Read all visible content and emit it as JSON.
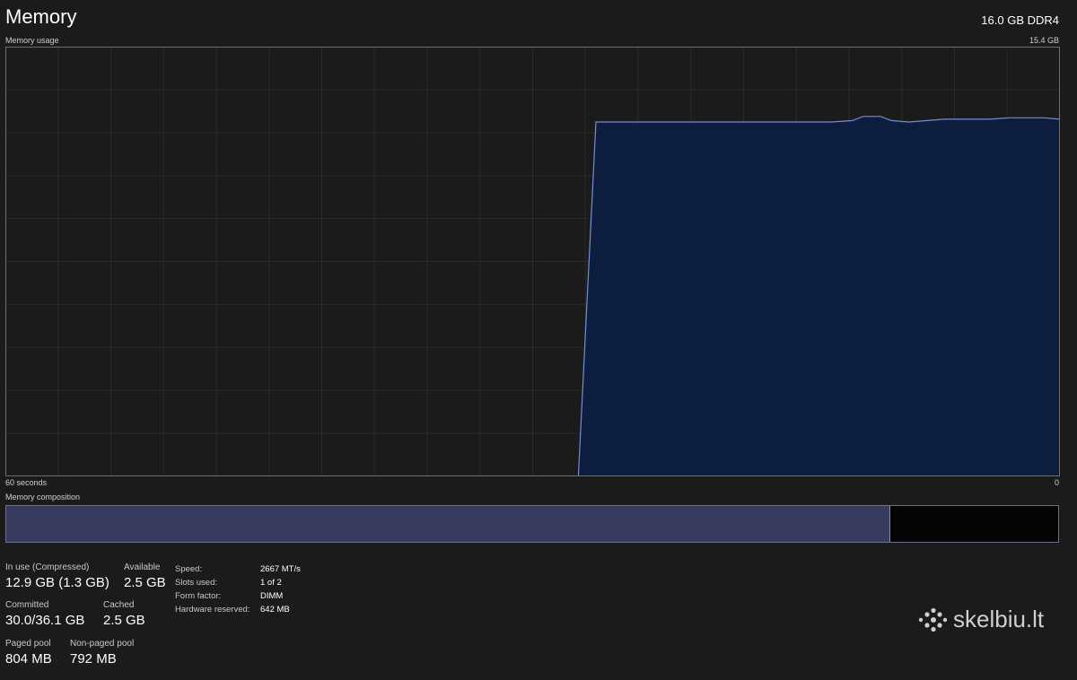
{
  "header": {
    "title": "Memory",
    "spec": "16.0 GB DDR4"
  },
  "chart": {
    "label": "Memory usage",
    "max_label": "15.4 GB",
    "x_left_label": "60 seconds",
    "x_right_label": "0",
    "line_color": "#6f8fd8",
    "fill_color": "#0d1e3f",
    "grid_color": "#2b2b2b"
  },
  "composition": {
    "label": "Memory composition",
    "in_use_fraction": 0.84,
    "modified_fraction": 0.002,
    "in_use_color": "#383a5e"
  },
  "stats": {
    "in_use": {
      "label": "In use (Compressed)",
      "value": "12.9 GB (1.3 GB)"
    },
    "available": {
      "label": "Available",
      "value": "2.5 GB"
    },
    "committed": {
      "label": "Committed",
      "value": "30.0/36.1 GB"
    },
    "cached": {
      "label": "Cached",
      "value": "2.5 GB"
    },
    "paged_pool": {
      "label": "Paged pool",
      "value": "804 MB"
    },
    "non_paged_pool": {
      "label": "Non-paged pool",
      "value": "792 MB"
    }
  },
  "hardware": [
    {
      "key": "Speed:",
      "value": "2667 MT/s"
    },
    {
      "key": "Slots used:",
      "value": "1 of 2"
    },
    {
      "key": "Form factor:",
      "value": "DIMM"
    },
    {
      "key": "Hardware reserved:",
      "value": "642 MB"
    }
  ],
  "watermark": {
    "text": "skelbiu.lt"
  },
  "chart_data": {
    "type": "area",
    "xlabel": "60 seconds",
    "ylabel": "Memory usage",
    "xlim": [
      60,
      0
    ],
    "ylim": [
      0,
      15.4
    ],
    "x": [
      27.4,
      26.4,
      13.0,
      11.8,
      11.2,
      10.2,
      9.6,
      8.6,
      6.6,
      4.0,
      2.9,
      0.9,
      0
    ],
    "series": [
      {
        "values": [
          0,
          12.7,
          12.7,
          12.75,
          12.9,
          12.9,
          12.75,
          12.7,
          12.8,
          12.8,
          12.85,
          12.85,
          12.8
        ]
      }
    ]
  }
}
